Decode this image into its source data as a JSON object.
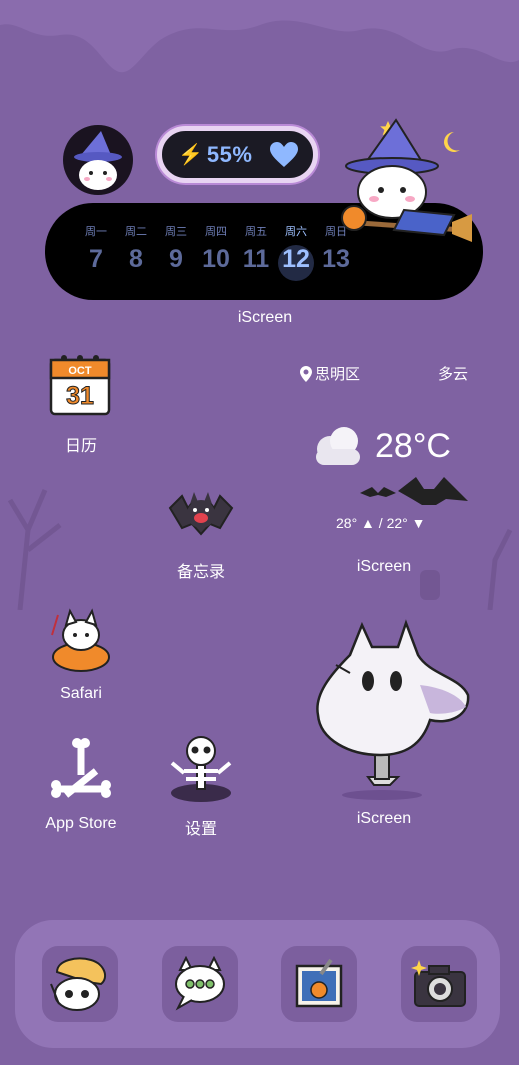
{
  "top_widget": {
    "battery_percent": "55%",
    "weekdays": [
      "周一",
      "周二",
      "周三",
      "周四",
      "周五",
      "周六",
      "周日"
    ],
    "dates": [
      "7",
      "8",
      "9",
      "10",
      "11",
      "12",
      "13"
    ],
    "active_index": 5,
    "label": "iScreen"
  },
  "apps": {
    "calendar": {
      "label": "日历",
      "month": "OCT",
      "day": "31"
    },
    "memo": {
      "label": "备忘录"
    },
    "safari": {
      "label": "Safari"
    },
    "appstore": {
      "label": "App Store"
    },
    "settings": {
      "label": "设置"
    }
  },
  "weather_widget": {
    "location": "思明区",
    "condition": "多云",
    "temperature": "28°C",
    "high": "28°",
    "low": "22°",
    "label": "iScreen"
  },
  "ghost_widget": {
    "label": "iScreen"
  },
  "colors": {
    "background": "#7f62a2",
    "dock": "#9275b6",
    "accent_blue": "#8fb8ff"
  }
}
